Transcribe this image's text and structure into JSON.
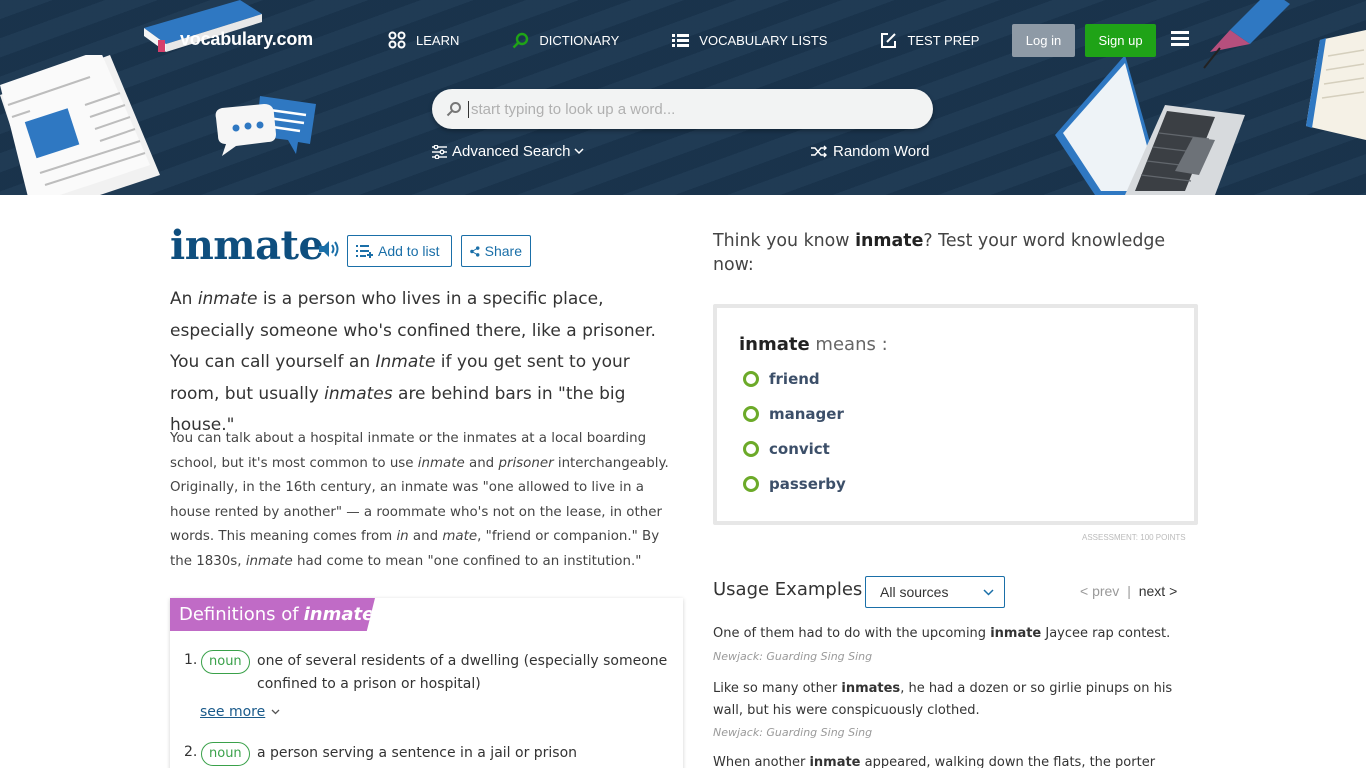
{
  "header": {
    "logo_text": "vocabulary.com",
    "nav": [
      {
        "label": "LEARN",
        "icon": "grid-icon"
      },
      {
        "label": "DICTIONARY",
        "icon": "magnifier-icon"
      },
      {
        "label": "VOCABULARY LISTS",
        "icon": "list-icon"
      },
      {
        "label": "TEST PREP",
        "icon": "pencil-square-icon"
      }
    ],
    "login_label": "Log in",
    "signup_label": "Sign up",
    "search_placeholder": "start typing to look up a word...",
    "advanced_search_label": "Advanced Search",
    "random_word_label": "Random Word",
    "colors": {
      "bg": "#1b3650",
      "signup": "#1fa317",
      "login": "#8e9aa6"
    }
  },
  "word": {
    "title": "inmate",
    "add_to_list_label": "Add to list",
    "share_label": "Share",
    "short_def": [
      {
        "t": "An "
      },
      {
        "t": "inmate",
        "i": true
      },
      {
        "t": " is a person who lives in a specific place, especially someone who's confined there, like a prisoner. You can call yourself an "
      },
      {
        "t": "Inmate",
        "i": true
      },
      {
        "t": " if you get sent to your room, but usually "
      },
      {
        "t": "inmates",
        "i": true
      },
      {
        "t": " are behind bars in \"the big house.\""
      }
    ],
    "long_def": [
      {
        "t": "You can talk about a hospital inmate or the inmates at a local boarding school, but it's most common to use "
      },
      {
        "t": "inmate",
        "i": true
      },
      {
        "t": " and "
      },
      {
        "t": "prisoner",
        "i": true
      },
      {
        "t": " interchangeably. Originally, in the 16th century, an inmate was \"one allowed to live in a house rented by another\" — a roommate who's not on the lease, in other words. This meaning comes from "
      },
      {
        "t": "in",
        "i": true
      },
      {
        "t": " and "
      },
      {
        "t": "mate",
        "i": true
      },
      {
        "t": ", \"friend or companion.\" By the 1830s, "
      },
      {
        "t": "inmate",
        "i": true
      },
      {
        "t": " had come to mean \"one confined to an institution.\""
      }
    ]
  },
  "definitions": {
    "banner_prefix": "Definitions of",
    "banner_word": "inmate",
    "items": [
      {
        "num": "1.",
        "pos": "noun",
        "text": "one of several residents of a dwelling (especially someone confined to a prison or hospital)"
      },
      {
        "num": "2.",
        "pos": "noun",
        "text": "a person serving a sentence in a jail or prison"
      }
    ],
    "see_more_label": "see more"
  },
  "quiz": {
    "prompt_before": "Think you know ",
    "prompt_word": "inmate",
    "prompt_after": "? Test your word knowledge now:",
    "question_word": "inmate",
    "question_suffix": " means :",
    "options": [
      "friend",
      "manager",
      "convict",
      "passerby"
    ],
    "assessment": "ASSESSMENT: 100 POINTS"
  },
  "usage": {
    "title": "Usage Examples",
    "select_value": "All sources",
    "prev_label": "< prev",
    "separator": "|",
    "next_label": "next >",
    "examples": [
      {
        "before": "One of them had to do with the upcoming ",
        "word": "inmate",
        "after": " Jaycee rap contest.",
        "source": "Newjack: Guarding Sing Sing"
      },
      {
        "before": "Like so many other ",
        "word": "inmates",
        "after": ", he had a dozen or so girlie pinups on his wall, but his were conspicuously clothed.",
        "source": "Newjack: Guarding Sing Sing"
      },
      {
        "before": "When another ",
        "word": "inmate",
        "after": " appeared, walking down the flats, the porter attacked",
        "source": ""
      }
    ]
  }
}
